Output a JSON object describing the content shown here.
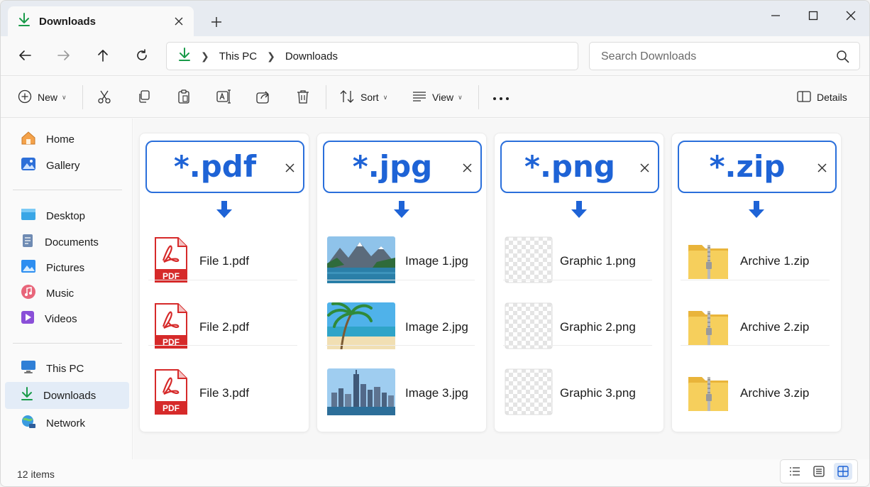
{
  "tab": {
    "title": "Downloads"
  },
  "address": {
    "segments": [
      "This PC",
      "Downloads"
    ]
  },
  "search": {
    "placeholder": "Search Downloads"
  },
  "commandbar": {
    "new_label": "New",
    "sort_label": "Sort",
    "view_label": "View",
    "details_label": "Details"
  },
  "sidebar": {
    "items": [
      "Home",
      "Gallery",
      "Desktop",
      "Documents",
      "Pictures",
      "Music",
      "Videos",
      "This PC",
      "Downloads",
      "Network"
    ],
    "active": "Downloads"
  },
  "filters": [
    {
      "pattern": "*.pdf",
      "files": [
        "File 1.pdf",
        "File 2.pdf",
        "File 3.pdf"
      ]
    },
    {
      "pattern": "*.jpg",
      "files": [
        "Image 1.jpg",
        "Image 2.jpg",
        "Image 3.jpg"
      ]
    },
    {
      "pattern": "*.png",
      "files": [
        "Graphic 1.png",
        "Graphic 2.png",
        "Graphic 3.png"
      ]
    },
    {
      "pattern": "*.zip",
      "files": [
        "Archive 1.zip",
        "Archive 2.zip",
        "Archive 3.zip"
      ]
    }
  ],
  "status": {
    "item_count": "12 items",
    "active_view": "tiles"
  },
  "colors": {
    "accent": "#1e63d6",
    "downloads_green": "#1a9b4a",
    "pdf_red": "#d62a2a",
    "zip_yellow": "#f2c44f"
  }
}
